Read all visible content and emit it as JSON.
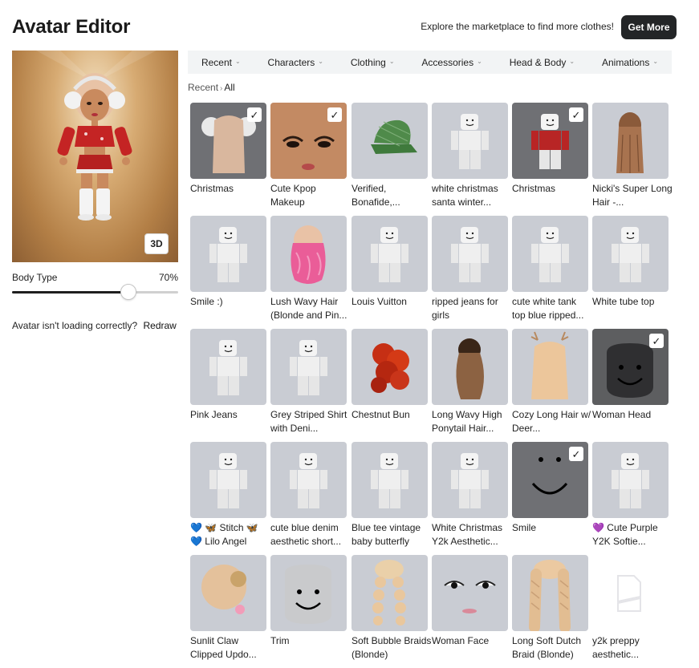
{
  "title": "Avatar Editor",
  "promo_text": "Explore the marketplace to find more clothes!",
  "get_more_label": "Get More",
  "preview": {
    "view_toggle_label": "3D"
  },
  "body_type": {
    "label": "Body Type",
    "value_text": "70%",
    "value": 0.7
  },
  "redraw": {
    "prompt": "Avatar isn't loading correctly?",
    "link": "Redraw"
  },
  "tabs": [
    {
      "label": "Recent"
    },
    {
      "label": "Characters"
    },
    {
      "label": "Clothing"
    },
    {
      "label": "Accessories"
    },
    {
      "label": "Head & Body"
    },
    {
      "label": "Animations"
    }
  ],
  "breadcrumb": {
    "parent": "Recent",
    "current": "All"
  },
  "items": [
    {
      "name": "Christmas",
      "selected": true,
      "icon": "hair-earmuffs-icon"
    },
    {
      "name": "Cute Kpop Makeup",
      "selected": true,
      "icon": "face-makeup-icon"
    },
    {
      "name": "Verified, Bonafide,...",
      "selected": false,
      "icon": "green-cap-icon"
    },
    {
      "name": "white christmas santa winter...",
      "selected": false,
      "icon": "blocky-avatar-icon"
    },
    {
      "name": "Christmas",
      "selected": true,
      "icon": "red-top-icon"
    },
    {
      "name": "Nicki's Super Long Hair -...",
      "selected": false,
      "icon": "long-hair-icon"
    },
    {
      "name": "Smile :)",
      "selected": false,
      "icon": "blocky-avatar-icon"
    },
    {
      "name": "Lush Wavy Hair (Blonde and Pin...",
      "selected": false,
      "icon": "pink-wavy-hair-icon"
    },
    {
      "name": "Louis Vuitton",
      "selected": false,
      "icon": "blocky-avatar-icon"
    },
    {
      "name": "ripped jeans for girls",
      "selected": false,
      "icon": "blocky-avatar-icon"
    },
    {
      "name": "cute white tank top blue ripped...",
      "selected": false,
      "icon": "blocky-avatar-icon"
    },
    {
      "name": "White tube top",
      "selected": false,
      "icon": "blocky-avatar-icon"
    },
    {
      "name": "Pink Jeans",
      "selected": false,
      "icon": "blocky-avatar-icon"
    },
    {
      "name": "Grey Striped Shirt with Deni...",
      "selected": false,
      "icon": "blocky-avatar-icon"
    },
    {
      "name": "Chestnut Bun",
      "selected": false,
      "icon": "red-curly-hair-icon"
    },
    {
      "name": "Long Wavy High Ponytail Hair...",
      "selected": false,
      "icon": "brown-hair-icon"
    },
    {
      "name": "Cozy Long Hair w/ Deer...",
      "selected": false,
      "icon": "deer-antler-hair-icon"
    },
    {
      "name": "Woman Head",
      "selected": true,
      "icon": "dark-head-icon"
    },
    {
      "name": "💙 🦋 Stitch 🦋 💙 Lilo Angel",
      "selected": false,
      "icon": "blocky-avatar-icon"
    },
    {
      "name": "cute blue denim aesthetic short...",
      "selected": false,
      "icon": "blocky-avatar-icon"
    },
    {
      "name": "Blue tee vintage baby butterfly",
      "selected": false,
      "icon": "blocky-avatar-icon"
    },
    {
      "name": "White Christmas Y2k Aesthetic...",
      "selected": false,
      "icon": "blocky-avatar-icon"
    },
    {
      "name": "Smile",
      "selected": true,
      "icon": "smile-face-icon"
    },
    {
      "name": "💜 Cute Purple Y2K Softie...",
      "selected": false,
      "icon": "blocky-avatar-icon"
    },
    {
      "name": "Sunlit Claw Clipped Updo...",
      "selected": false,
      "icon": "updo-hair-icon"
    },
    {
      "name": "Trim",
      "selected": false,
      "icon": "grey-head-icon"
    },
    {
      "name": "Soft Bubble Braids (Blonde)",
      "selected": false,
      "icon": "bubble-braids-icon"
    },
    {
      "name": "Woman Face",
      "selected": false,
      "icon": "woman-face-icon"
    },
    {
      "name": "Long Soft Dutch Braid (Blonde)",
      "selected": false,
      "icon": "dutch-braid-icon"
    },
    {
      "name": "y2k preppy aesthetic...",
      "selected": false,
      "icon": "image-placeholder-icon"
    }
  ],
  "colors": {
    "tile_bg": "#c9ccd3",
    "tile_selected_bg": "#6f7074",
    "button_dark": "#232527",
    "tab_bar_bg": "#f2f4f5"
  }
}
